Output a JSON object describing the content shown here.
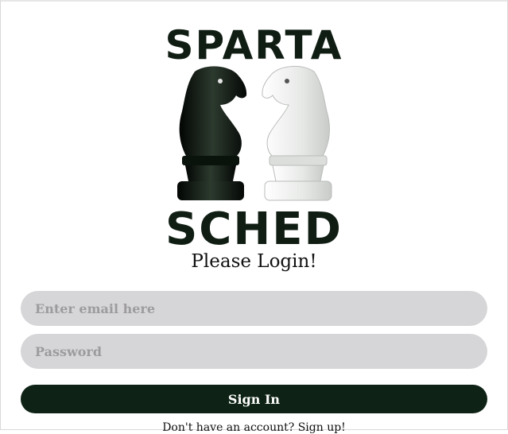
{
  "logo": {
    "line1": "SPARTA",
    "line2": "SCHED"
  },
  "login": {
    "heading": "Please Login!",
    "email_placeholder": "Enter email here",
    "password_placeholder": "Password",
    "signin_label": "Sign In",
    "signup_prompt": "Don't have an account? Sign up!"
  },
  "colors": {
    "brand_dark": "#0e2315",
    "input_bg": "#d6d5d7"
  },
  "icons": [
    "black-knight-icon",
    "white-knight-icon"
  ]
}
